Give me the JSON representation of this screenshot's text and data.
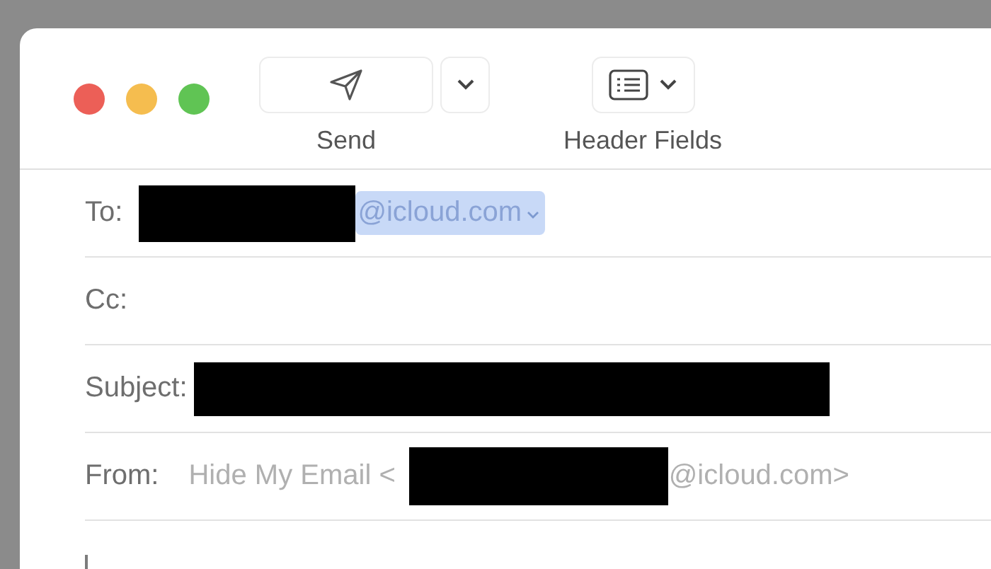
{
  "toolbar": {
    "items": [
      {
        "kind": "split",
        "label": "Send"
      },
      {
        "kind": "menu",
        "label": "Header Fields"
      }
    ]
  },
  "fields": [
    {
      "kind": "recipient",
      "label": "To:",
      "chip": {
        "text": "@icloud.com",
        "selected": true
      }
    },
    {
      "kind": "empty",
      "label": "Cc:"
    },
    {
      "kind": "subject",
      "label": "Subject:"
    },
    {
      "kind": "from",
      "label": "From:",
      "prefix": "Hide My Email <",
      "suffix": "@icloud.com>"
    }
  ]
}
